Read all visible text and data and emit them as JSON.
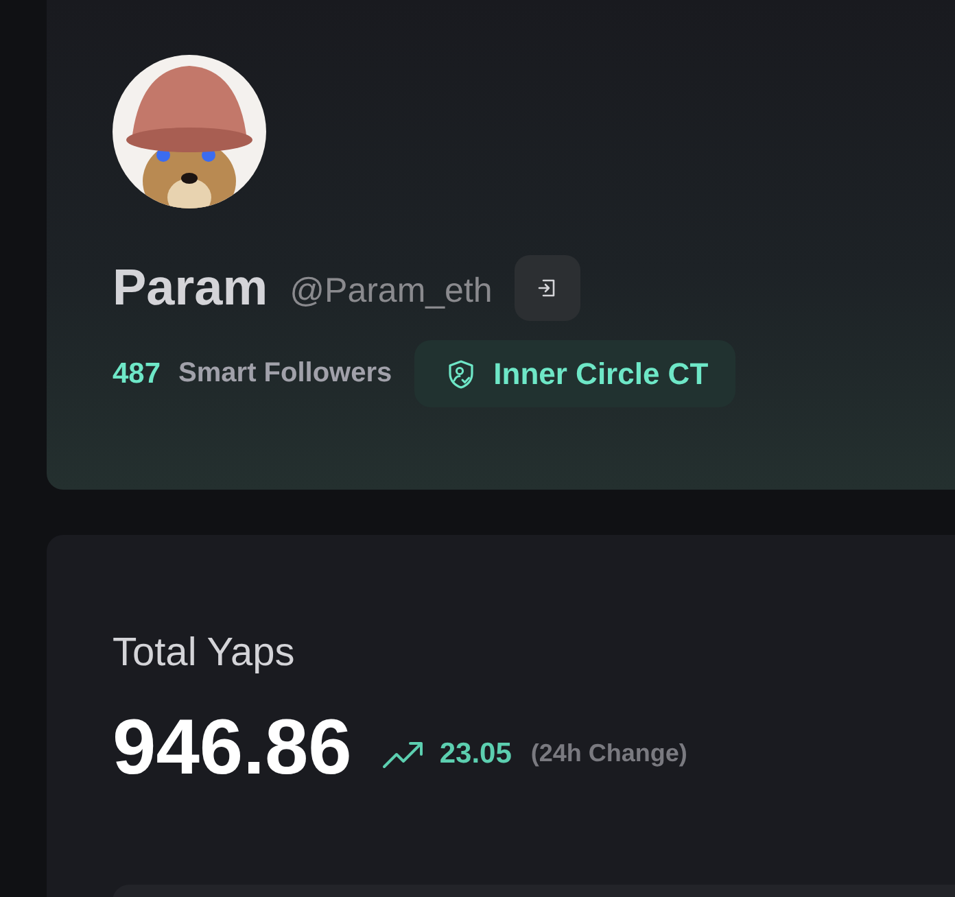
{
  "profile": {
    "name": "Param",
    "handle": "@Param_eth",
    "smart_followers": {
      "count": "487",
      "label": "Smart Followers"
    },
    "badge": "Inner Circle CT"
  },
  "yaps": {
    "title": "Total Yaps",
    "total": "946.86",
    "change": "23.05",
    "change_label": "(24h Change)",
    "rising": true
  }
}
